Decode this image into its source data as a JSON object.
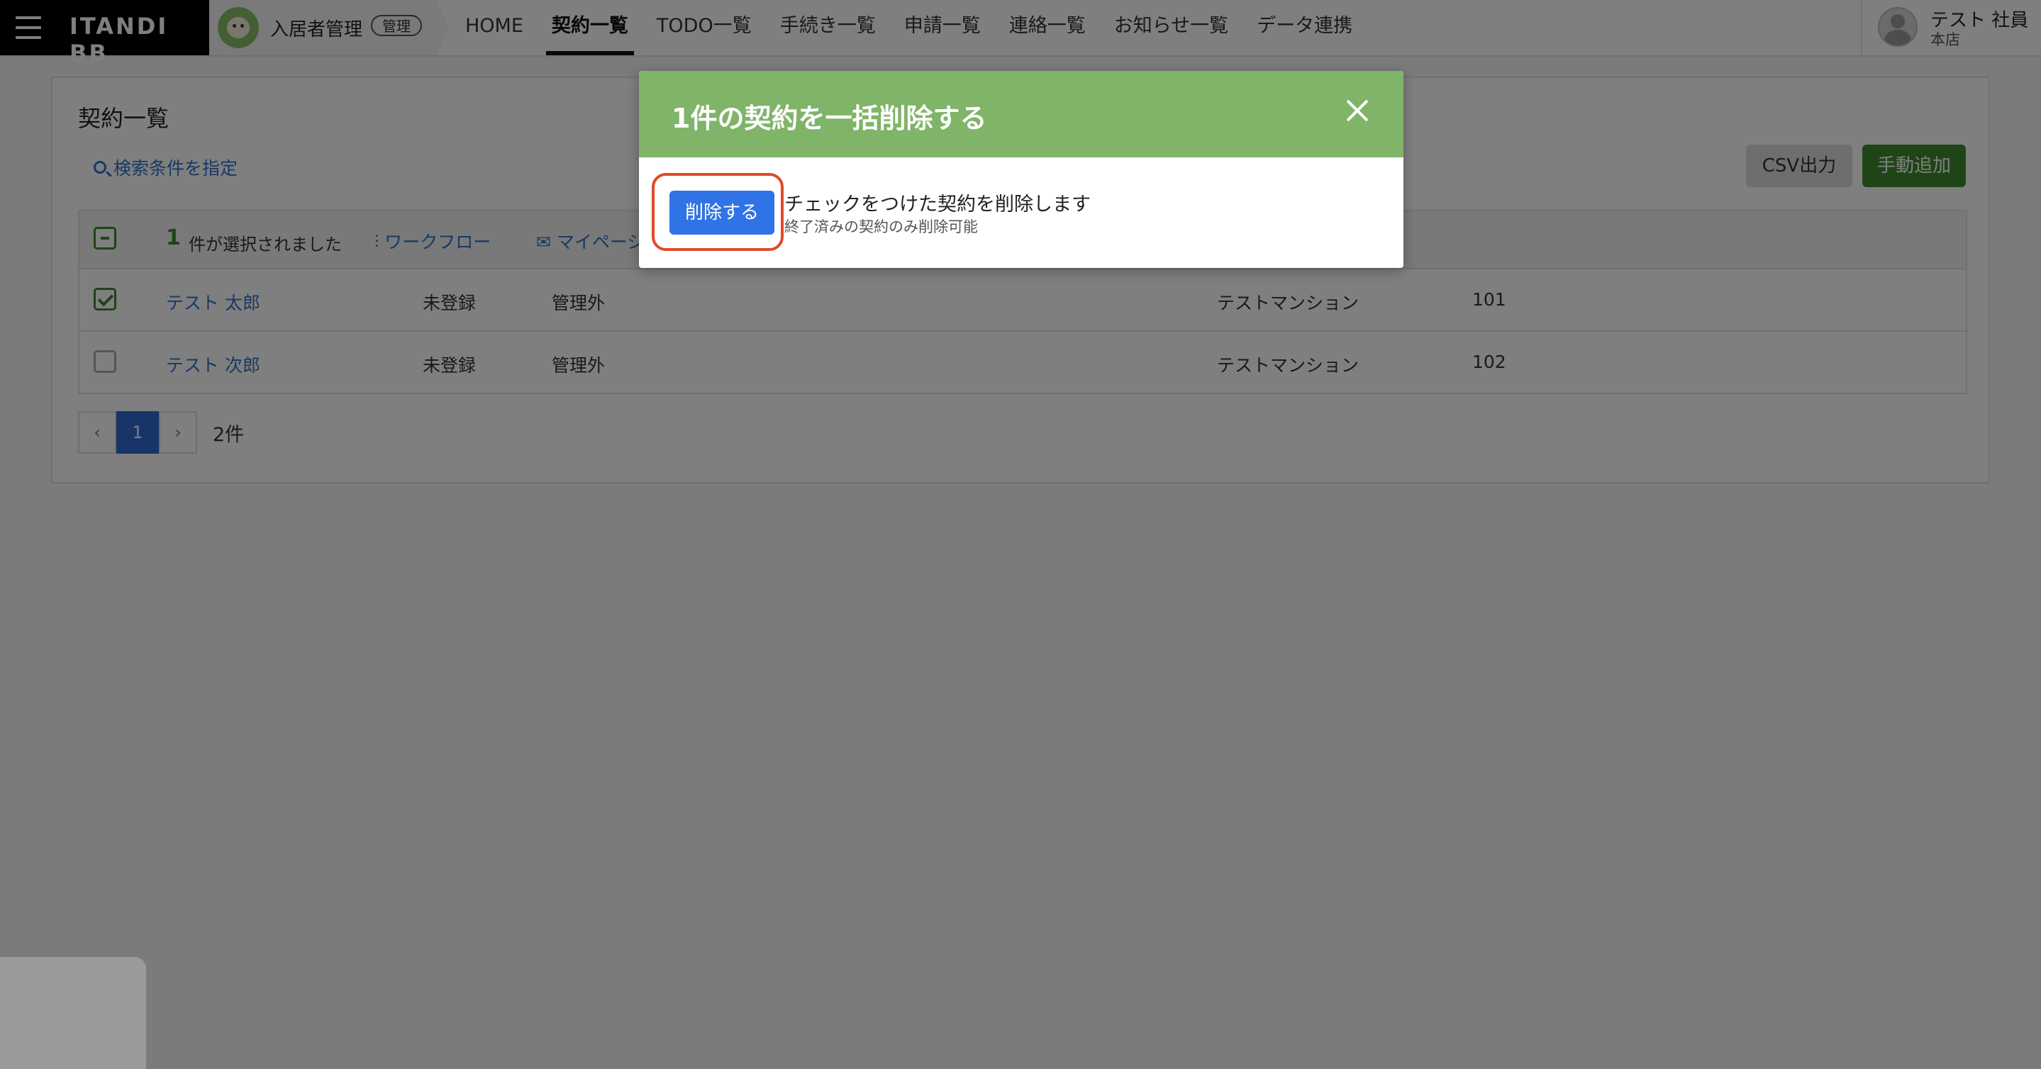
{
  "nav": {
    "logo": "ITANDI BB",
    "app_name": "入居者管理",
    "app_badge": "管理",
    "items": [
      {
        "label": "HOME",
        "active": false
      },
      {
        "label": "契約一覧",
        "active": true
      },
      {
        "label": "TODO一覧",
        "active": false
      },
      {
        "label": "手続き一覧",
        "active": false
      },
      {
        "label": "申請一覧",
        "active": false
      },
      {
        "label": "連絡一覧",
        "active": false
      },
      {
        "label": "お知らせ一覧",
        "active": false
      },
      {
        "label": "データ連携",
        "active": false
      }
    ],
    "user_name": "テスト 社員",
    "user_branch": "本店"
  },
  "page": {
    "title": "契約一覧",
    "search_link": "検索条件を指定",
    "csv_button": "CSV出力",
    "add_button": "手動追加"
  },
  "table": {
    "selected_count": "1",
    "selected_text": "件が選択されました",
    "workflow_link": "ワークフロー",
    "mypage_link": "マイページ",
    "rows": [
      {
        "checked": true,
        "name": "テスト 太郎",
        "status": "未登録",
        "management": "管理外",
        "property": "テストマンション",
        "room": "101"
      },
      {
        "checked": false,
        "name": "テスト 次郎",
        "status": "未登録",
        "management": "管理外",
        "property": "テストマンション",
        "room": "102"
      }
    ]
  },
  "pagination": {
    "prev": "‹",
    "current": "1",
    "next": "›",
    "total": "2件"
  },
  "modal": {
    "title": "1件の契約を一括削除する",
    "delete_button": "削除する",
    "message": "チェックをつけた契約を削除します",
    "sub_message": "終了済みの契約のみ削除可能"
  },
  "colors": {
    "modal_header": "#80b469",
    "primary_blue": "#2f73e6",
    "brand_green": "#3f8a2f",
    "highlight_red": "#e04a2a"
  }
}
